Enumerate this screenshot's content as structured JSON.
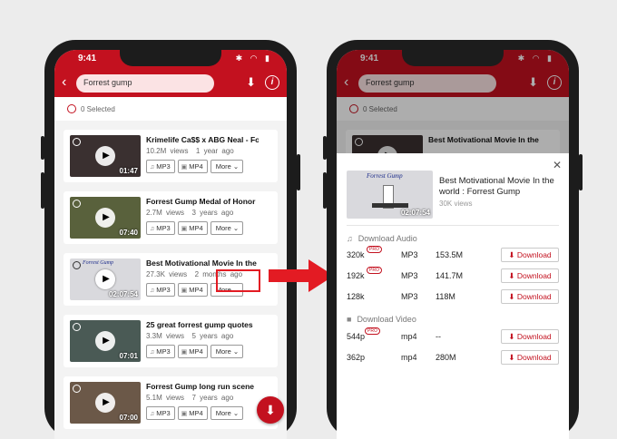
{
  "status": {
    "time": "9:41",
    "icons": "✱ ◠ ▮"
  },
  "search": {
    "query": "Forrest  gump"
  },
  "selection": {
    "label": "0 Selected"
  },
  "chips": {
    "mp3": "MP3",
    "mp4": "MP4",
    "more": "More"
  },
  "videos": [
    {
      "title": "Krimelife Ca$$ x ABG Neal - Forr...",
      "views": "10.2M views",
      "age": "1 year ago",
      "duration": "01:47",
      "thumb_color": "#3a3030"
    },
    {
      "title": "Forrest Gump Medal of Honor",
      "views": "2.7M views",
      "age": "3 years ago",
      "duration": "07:40",
      "thumb_color": "#59613c"
    },
    {
      "title": "Best Motivational Movie In the ...",
      "views": "27.3K views",
      "age": "2 months ago",
      "duration": "02:07:54",
      "thumb_color": "#d9d9dd",
      "overlay": "Forrest Gump"
    },
    {
      "title": "25 great forrest gump quotes",
      "views": "3.3M views",
      "age": "5 years ago",
      "duration": "07:01",
      "thumb_color": "#4a5a55"
    },
    {
      "title": "Forrest Gump long run scene",
      "views": "5.1M views",
      "age": "7 years ago",
      "duration": "07:00",
      "thumb_color": "#6b5848"
    }
  ],
  "sheet": {
    "title": "Best Motivational Movie In the world : Forrest Gump",
    "views": "30K views",
    "duration": "02:07:54",
    "thumb_overlay": "Forrest Gump",
    "audio_label": "Download Audio",
    "video_label": "Download Video",
    "pro_badge": "PRO",
    "download_label": "Download",
    "audio": [
      {
        "quality": "320k",
        "pro": true,
        "format": "MP3",
        "size": "153.5M"
      },
      {
        "quality": "192k",
        "pro": true,
        "format": "MP3",
        "size": "141.7M"
      },
      {
        "quality": "128k",
        "pro": false,
        "format": "MP3",
        "size": "118M"
      }
    ],
    "video": [
      {
        "quality": "544p",
        "pro": true,
        "format": "mp4",
        "size": "--"
      },
      {
        "quality": "362p",
        "pro": false,
        "format": "mp4",
        "size": "280M"
      }
    ]
  },
  "colors": {
    "brand": "#c3111f",
    "highlight": "#e31b23"
  }
}
